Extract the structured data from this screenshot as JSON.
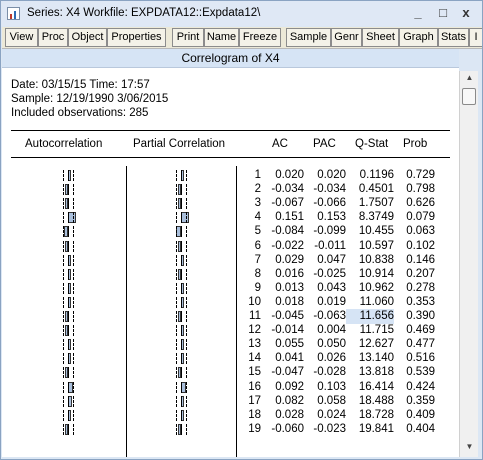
{
  "window": {
    "title": "Series: X4   Workfile: EXPDATA12::Expdata12\\",
    "minimize_label": "_",
    "maximize_label": "□",
    "close_label": "x"
  },
  "toolbar": {
    "buttons": [
      "View",
      "Proc",
      "Object",
      "Properties",
      "Print",
      "Name",
      "Freeze",
      "Sample",
      "Genr",
      "Sheet",
      "Graph",
      "Stats",
      "I"
    ]
  },
  "view": {
    "header": "Correlogram of X4",
    "date_line": "Date: 03/15/15   Time: 17:57",
    "sample_line": "Sample: 12/19/1990 3/06/2015",
    "obs_line": "Included observations: 285"
  },
  "columns": {
    "autocorrelation": "Autocorrelation",
    "partial_correlation": "Partial Correlation",
    "ac": "AC",
    "pac": "PAC",
    "qstat": "Q-Stat",
    "prob": "Prob"
  },
  "rows": [
    {
      "lag": "1",
      "ac": "0.020",
      "pac": "0.020",
      "qstat": "0.1196",
      "prob": "0.729"
    },
    {
      "lag": "2",
      "ac": "-0.034",
      "pac": "-0.034",
      "qstat": "0.4501",
      "prob": "0.798"
    },
    {
      "lag": "3",
      "ac": "-0.067",
      "pac": "-0.066",
      "qstat": "1.7507",
      "prob": "0.626"
    },
    {
      "lag": "4",
      "ac": "0.151",
      "pac": "0.153",
      "qstat": "8.3749",
      "prob": "0.079"
    },
    {
      "lag": "5",
      "ac": "-0.084",
      "pac": "-0.099",
      "qstat": "10.455",
      "prob": "0.063"
    },
    {
      "lag": "6",
      "ac": "-0.022",
      "pac": "-0.011",
      "qstat": "10.597",
      "prob": "0.102"
    },
    {
      "lag": "7",
      "ac": "0.029",
      "pac": "0.047",
      "qstat": "10.838",
      "prob": "0.146"
    },
    {
      "lag": "8",
      "ac": "0.016",
      "pac": "-0.025",
      "qstat": "10.914",
      "prob": "0.207"
    },
    {
      "lag": "9",
      "ac": "0.013",
      "pac": "0.043",
      "qstat": "10.962",
      "prob": "0.278"
    },
    {
      "lag": "10",
      "ac": "0.018",
      "pac": "0.019",
      "qstat": "11.060",
      "prob": "0.353"
    },
    {
      "lag": "11",
      "ac": "-0.045",
      "pac": "-0.063",
      "qstat": "11.656",
      "prob": "0.390"
    },
    {
      "lag": "12",
      "ac": "-0.014",
      "pac": "0.004",
      "qstat": "11.715",
      "prob": "0.469"
    },
    {
      "lag": "13",
      "ac": "0.055",
      "pac": "0.050",
      "qstat": "12.627",
      "prob": "0.477"
    },
    {
      "lag": "14",
      "ac": "0.041",
      "pac": "0.026",
      "qstat": "13.140",
      "prob": "0.516"
    },
    {
      "lag": "15",
      "ac": "-0.047",
      "pac": "-0.028",
      "qstat": "13.818",
      "prob": "0.539"
    },
    {
      "lag": "16",
      "ac": "0.092",
      "pac": "0.103",
      "qstat": "16.414",
      "prob": "0.424"
    },
    {
      "lag": "17",
      "ac": "0.082",
      "pac": "0.058",
      "qstat": "18.488",
      "prob": "0.359"
    },
    {
      "lag": "18",
      "ac": "0.028",
      "pac": "0.024",
      "qstat": "18.728",
      "prob": "0.409"
    },
    {
      "lag": "19",
      "ac": "-0.060",
      "pac": "-0.023",
      "qstat": "19.841",
      "prob": "0.404"
    }
  ],
  "highlighted_cell": {
    "row_lag": "11",
    "column": "qstat"
  },
  "colors": {
    "titlebar_bg": "#dfe8f5",
    "header_bg": "#d6e4f5",
    "bar_fill": "#a9bfdc",
    "toolbar_bg": "#ece9d8"
  },
  "icons": {
    "app": "eviews-series-icon",
    "scroll_up": "scroll-up-arrow-icon",
    "scroll_down": "scroll-down-arrow-icon"
  }
}
